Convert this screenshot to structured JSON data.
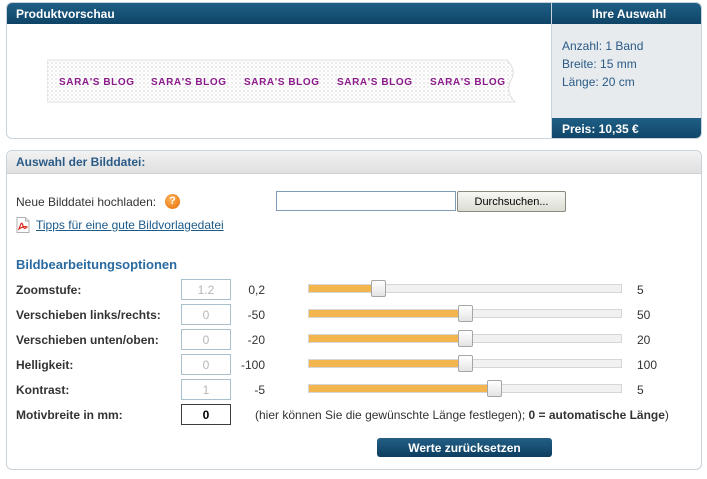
{
  "preview": {
    "title": "Produktvorschau",
    "ribbon_text": "SARA'S BLOG"
  },
  "selection": {
    "title": "Ihre Auswahl",
    "quantity": "Anzahl: 1 Band",
    "width": "Breite: 15 mm",
    "length": "Länge: 20 cm",
    "price": "Preis: 10,35 €"
  },
  "image_file": {
    "title": "Auswahl der Bilddatei:",
    "upload_label": "Neue Bilddatei hochladen:",
    "help_glyph": "?",
    "file_value": "",
    "browse_label": "Durchsuchen...",
    "tips_link": "Tipps für eine gute Bildvorlagedatei"
  },
  "options": {
    "title": "Bildbearbeitungsoptionen",
    "rows": [
      {
        "label": "Zoomstufe:",
        "value": "1.2",
        "min": "0,2",
        "max": "5",
        "level": 0.21
      },
      {
        "label": "Verschieben links/rechts:",
        "value": "0",
        "min": "-50",
        "max": "50",
        "level": 0.5
      },
      {
        "label": "Verschieben unten/oben:",
        "value": "0",
        "min": "-20",
        "max": "20",
        "level": 0.5
      },
      {
        "label": "Helligkeit:",
        "value": "0",
        "min": "-100",
        "max": "100",
        "level": 0.5
      },
      {
        "label": "Kontrast:",
        "value": "1",
        "min": "-5",
        "max": "5",
        "level": 0.6
      }
    ],
    "motif": {
      "label": "Motivbreite in mm:",
      "value": "0",
      "hint_prefix": "(hier können Sie die gewünschte Länge festlegen);",
      "hint_bold": "0 = automatische Länge",
      "hint_suffix": ")"
    },
    "reset_label": "Werte zurücksetzen"
  },
  "colors": {
    "header_blue": "#0e4466",
    "slider_fill": "#f3b64f",
    "ribbon_text": "#8b1a8b",
    "link_blue": "#1c5a8a"
  },
  "icons": {
    "help": "help-icon",
    "pdf": "pdf-icon"
  }
}
